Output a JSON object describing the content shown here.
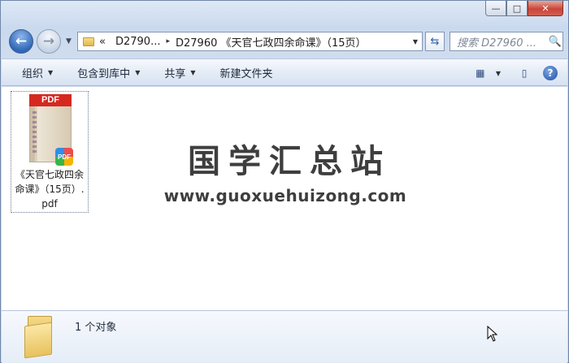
{
  "window": {
    "caption": {
      "minimize": "—",
      "maximize": "□",
      "close": "✕"
    }
  },
  "nav": {
    "back_icon": "←",
    "forward_icon": "→",
    "history_icon": "▼",
    "breadcrumb_prefix": "«",
    "crumbs": [
      "D2790...",
      "D27960 《天官七政四余命课》（15页）"
    ],
    "crumb_separator": "▸",
    "dropdown_icon": "▼",
    "refresh_icon": "⇆",
    "search_placeholder": "搜索 D27960 ...",
    "search_icon": "🔍"
  },
  "toolbar": {
    "organize": "组织",
    "include_in_library": "包含到库中",
    "share": "共享",
    "new_folder": "新建文件夹",
    "dropdown_arrow": "▼",
    "view_icon": "▦",
    "pane_icon": "▯",
    "help_icon": "?"
  },
  "content": {
    "file": {
      "thumb_header": "PDF",
      "badge": "PDF",
      "name": "《天官七政四余命课》（15页）.pdf"
    },
    "watermark": {
      "title": "国学汇总站",
      "url": "www.guoxuehuizong.com"
    }
  },
  "details": {
    "count": "1 个对象"
  }
}
